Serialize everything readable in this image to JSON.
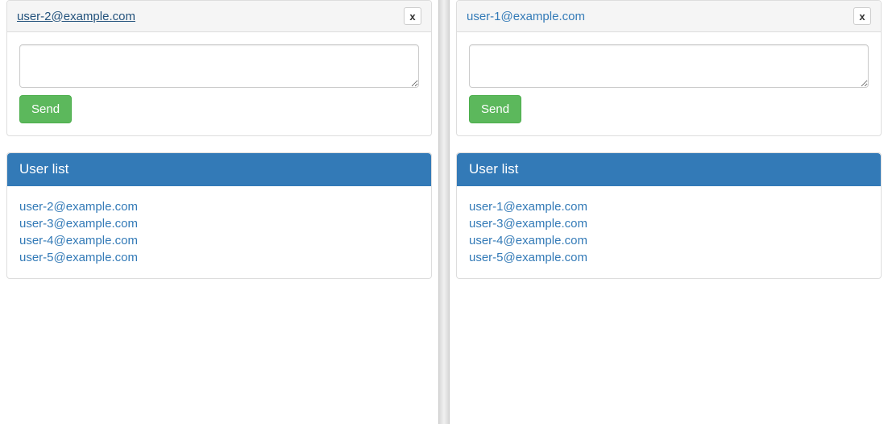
{
  "left": {
    "chat": {
      "header_link": "user-2@example.com",
      "header_underlined": true,
      "close_label": "x",
      "send_label": "Send",
      "input_value": ""
    },
    "userlist": {
      "title": "User list",
      "items": [
        "user-2@example.com",
        "user-3@example.com",
        "user-4@example.com",
        "user-5@example.com"
      ]
    }
  },
  "right": {
    "chat": {
      "header_link": "user-1@example.com",
      "header_underlined": false,
      "close_label": "x",
      "send_label": "Send",
      "input_value": ""
    },
    "userlist": {
      "title": "User list",
      "items": [
        "user-1@example.com",
        "user-3@example.com",
        "user-4@example.com",
        "user-5@example.com"
      ]
    }
  }
}
